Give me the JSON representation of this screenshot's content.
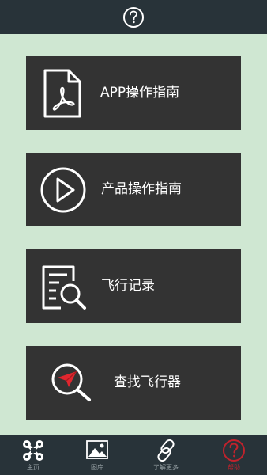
{
  "header": {
    "help_icon": "help-circle-icon"
  },
  "menu": [
    {
      "label": "APP操作指南",
      "icon": "pdf-document-icon"
    },
    {
      "label": "产品操作指南",
      "icon": "play-circle-icon"
    },
    {
      "label": "飞行记录",
      "icon": "document-search-icon"
    },
    {
      "label": "查找飞行器",
      "icon": "plane-search-icon"
    }
  ],
  "tabs": [
    {
      "label": "主页",
      "icon": "drone-icon",
      "active": false
    },
    {
      "label": "图库",
      "icon": "image-icon",
      "active": false
    },
    {
      "label": "了解更多",
      "icon": "link-icon",
      "active": false
    },
    {
      "label": "帮助",
      "icon": "help-icon",
      "active": true
    }
  ],
  "colors": {
    "background": "#cfe7d2",
    "bar": "#283339",
    "card": "#333333",
    "accent_red": "#c2222c"
  }
}
